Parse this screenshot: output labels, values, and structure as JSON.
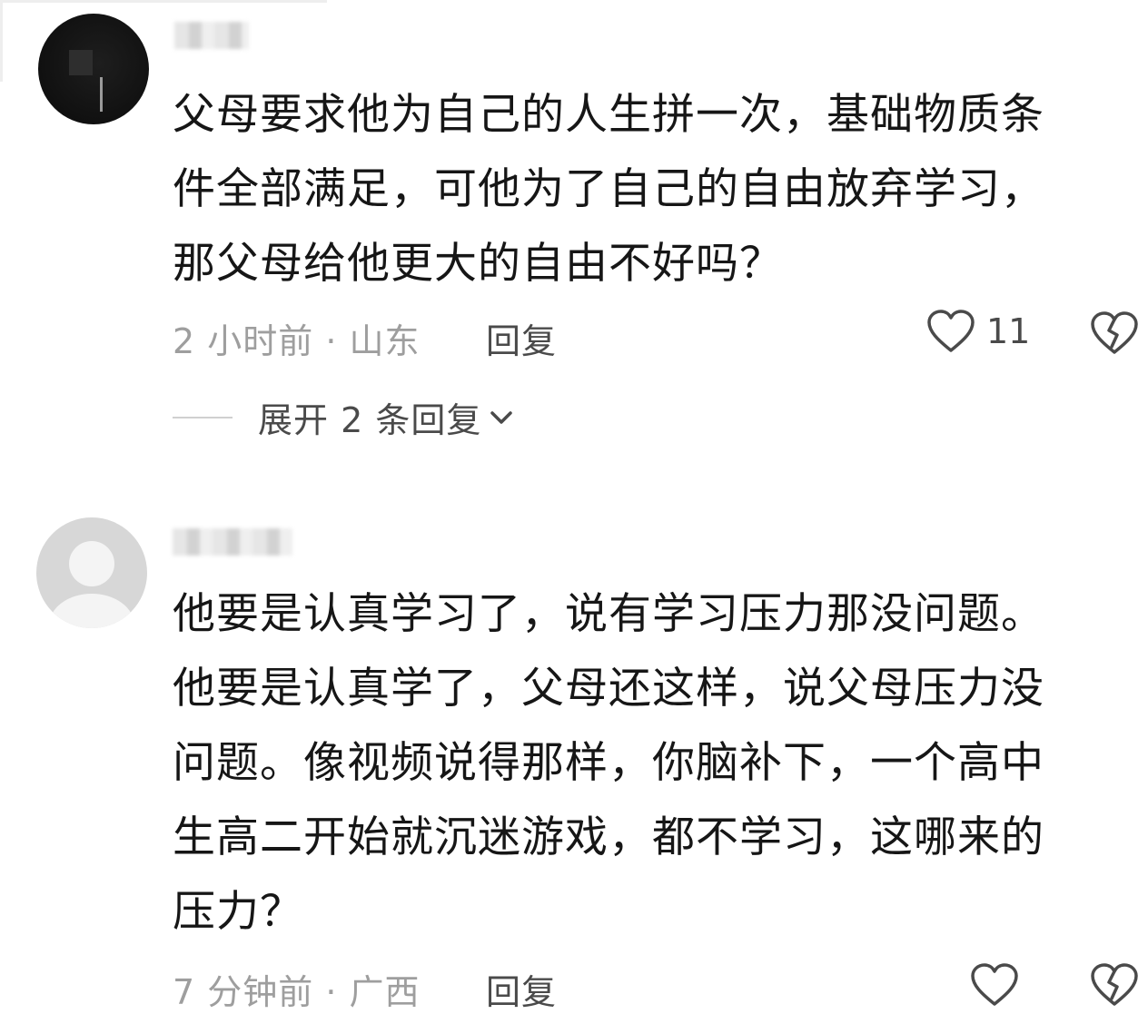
{
  "comments": [
    {
      "text_lines": [
        "父母要求他为自己的人生拼一次，基础物质条",
        "件全部满足，可他为了自己的自由放弃学习，",
        "那父母给他更大的自由不好吗？"
      ],
      "meta": "2 小时前 · 山东",
      "reply_label": "回复",
      "like_count": "11",
      "expand_label": "展开 2 条回复"
    },
    {
      "text_lines": [
        "他要是认真学习了，说有学习压力那没问题。",
        "他要是认真学了，父母还这样，说父母压力没",
        "问题。像视频说得那样，你脑补下，一个高中",
        "生高二开始就沉迷游戏，都不学习，这哪来的",
        "压力？"
      ],
      "meta": "7 分钟前 · 广西",
      "reply_label": "回复"
    }
  ],
  "icons": {
    "like": "heart-outline-icon",
    "dislike": "broken-heart-icon",
    "expand": "chevron-down-icon"
  },
  "colors": {
    "text": "#161616",
    "meta": "#9e9e9e",
    "action": "#4a4a4a"
  }
}
